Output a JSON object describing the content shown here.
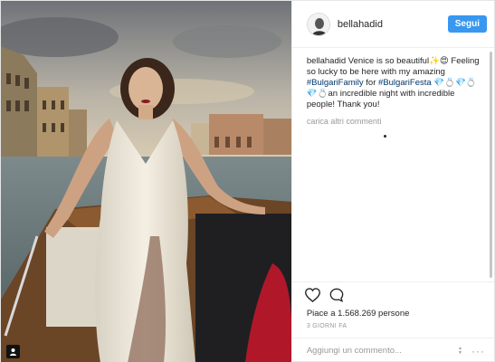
{
  "post": {
    "username": "bellahadid",
    "follow_label": "Segui",
    "caption": {
      "user": "bellahadid",
      "text_1": " Venice is so beautiful",
      "emoji_1": "✨😍",
      "text_2": " Feeling so lucky to be here with my amazing ",
      "tag_1": "#BulgariFamily",
      "text_3": " for ",
      "tag_2": "#BulgariFesta",
      "emoji_2": "💎💍💎💍💎💍",
      "text_4": "an incredible night with incredible people! Thank you!"
    },
    "load_more": "carica altri commenti",
    "likes_text": "Piace a 1.568.269 persone",
    "timestamp": "3 GIORNI FA",
    "comment_placeholder": "Aggiungi un commento...",
    "more_options": "···"
  },
  "colors": {
    "follow_bg": "#3897f0",
    "hashtag": "#003569",
    "muted": "#999999"
  },
  "icons": {
    "like": "heart-outline-icon",
    "comment": "speech-bubble-icon",
    "photo_badge": "user-tag-icon",
    "options": "ellipsis-icon"
  }
}
